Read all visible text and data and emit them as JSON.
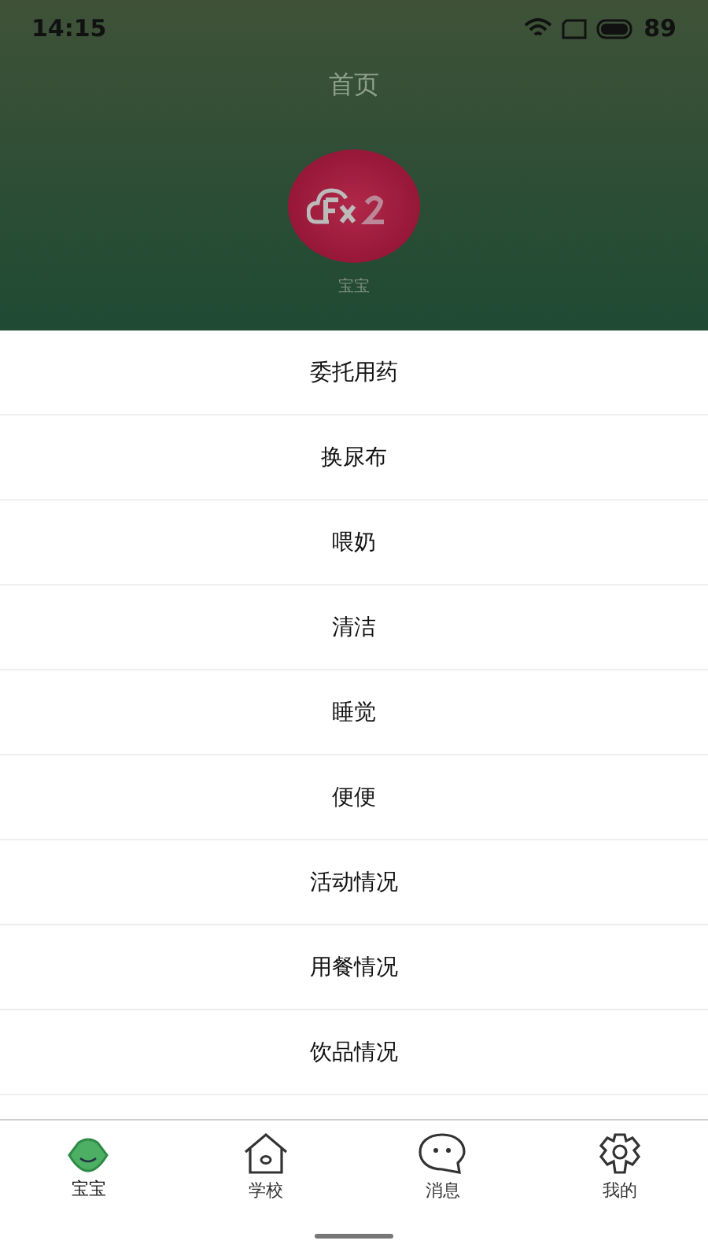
{
  "status_bar": {
    "time": "14:15",
    "battery": "89"
  },
  "header": {
    "title": "首页",
    "avatar_label": "宝宝"
  },
  "menu": [
    "委托用药",
    "换尿布",
    "喂奶",
    "清洁",
    "睡觉",
    "便便",
    "活动情况",
    "用餐情况",
    "饮品情况"
  ],
  "tabs": [
    {
      "label": "宝宝",
      "kind": "baby",
      "selected": true
    },
    {
      "label": "学校",
      "kind": "house",
      "selected": false
    },
    {
      "label": "消息",
      "kind": "chat",
      "selected": false
    },
    {
      "label": "我的",
      "kind": "gear",
      "selected": false
    }
  ]
}
